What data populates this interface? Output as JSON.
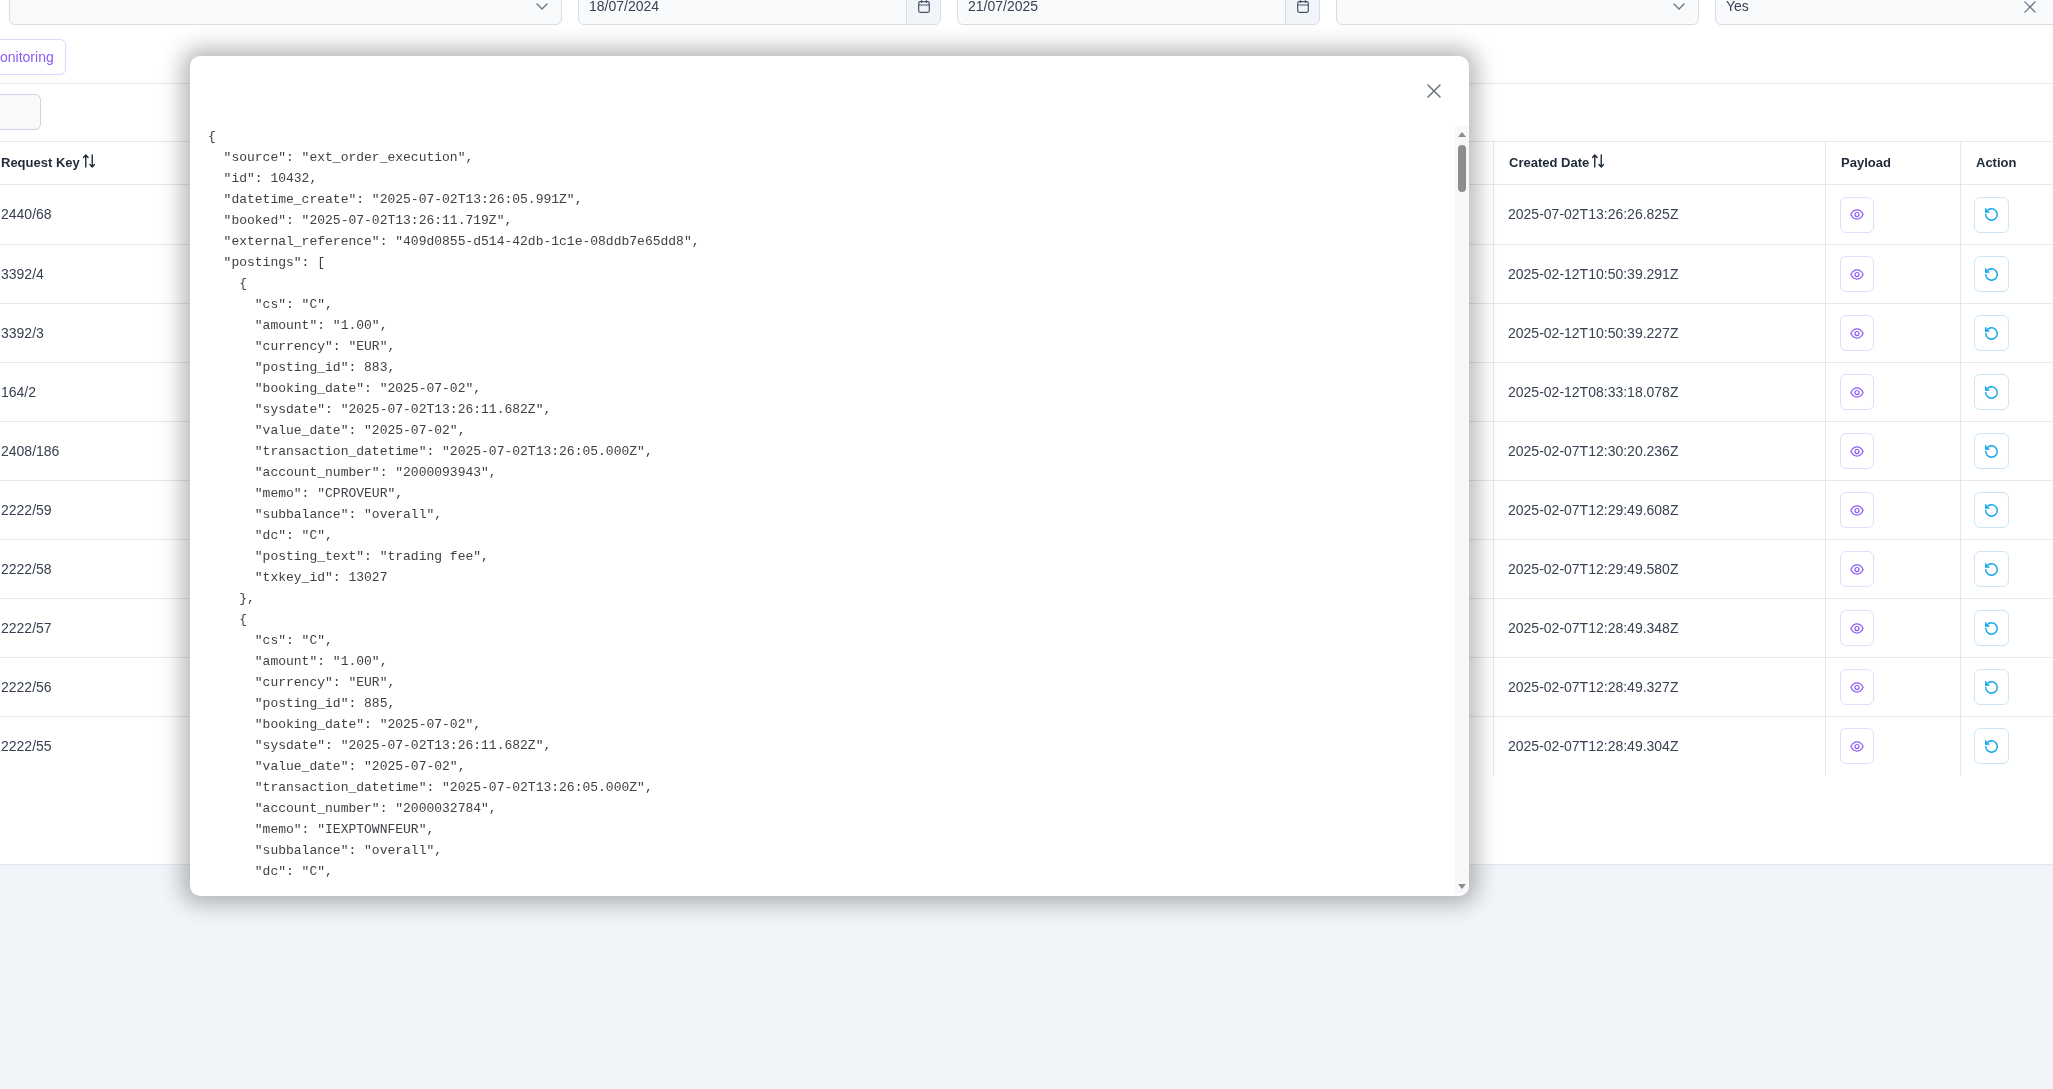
{
  "filters": [
    {
      "kind": "select"
    },
    {
      "kind": "date",
      "value": "18/07/2024"
    },
    {
      "kind": "date",
      "value": "21/07/2025"
    },
    {
      "kind": "select"
    },
    {
      "kind": "clearable",
      "value": "Yes"
    }
  ],
  "toolbar": {
    "button_label": "onitoring"
  },
  "table": {
    "columns": [
      {
        "label": "Request Key",
        "sortable": true,
        "kind": "text"
      },
      {
        "label": "Created Date",
        "sortable": true,
        "kind": "text"
      },
      {
        "label": "Payload",
        "sortable": false,
        "kind": "view"
      },
      {
        "label": "Action",
        "sortable": false,
        "kind": "retry"
      }
    ],
    "rows": [
      {
        "cells": [
          "2440/68",
          "2025-07-02T13:26:26.825Z"
        ]
      },
      {
        "cells": [
          "3392/4",
          "2025-02-12T10:50:39.291Z"
        ]
      },
      {
        "cells": [
          "3392/3",
          "2025-02-12T10:50:39.227Z"
        ]
      },
      {
        "cells": [
          "164/2",
          "2025-02-12T08:33:18.078Z"
        ]
      },
      {
        "cells": [
          "2408/186",
          "2025-02-07T12:30:20.236Z"
        ]
      },
      {
        "cells": [
          "2222/59",
          "2025-02-07T12:29:49.608Z"
        ]
      },
      {
        "cells": [
          "2222/58",
          "2025-02-07T12:29:49.580Z"
        ]
      },
      {
        "cells": [
          "2222/57",
          "2025-02-07T12:28:49.348Z"
        ]
      },
      {
        "cells": [
          "2222/56",
          "2025-02-07T12:28:49.327Z"
        ]
      },
      {
        "cells": [
          "2222/55",
          "2025-02-07T12:28:49.304Z"
        ]
      }
    ]
  },
  "payload_dialog": {
    "lines": [
      "{",
      "  \"source\": \"ext_order_execution\",",
      "  \"id\": 10432,",
      "  \"datetime_create\": \"2025-07-02T13:26:05.991Z\",",
      "  \"booked\": \"2025-07-02T13:26:11.719Z\",",
      "  \"external_reference\": \"409d0855-d514-42db-1c1e-08ddb7e65dd8\",",
      "  \"postings\": [",
      "    {",
      "      \"cs\": \"C\",",
      "      \"amount\": \"1.00\",",
      "      \"currency\": \"EUR\",",
      "      \"posting_id\": 883,",
      "      \"booking_date\": \"2025-07-02\",",
      "      \"sysdate\": \"2025-07-02T13:26:11.682Z\",",
      "      \"value_date\": \"2025-07-02\",",
      "      \"transaction_datetime\": \"2025-07-02T13:26:05.000Z\",",
      "      \"account_number\": \"2000093943\",",
      "      \"memo\": \"CPROVEUR\",",
      "      \"subbalance\": \"overall\",",
      "      \"dc\": \"C\",",
      "      \"posting_text\": \"trading fee\",",
      "      \"txkey_id\": 13027",
      "    },",
      "    {",
      "      \"cs\": \"C\",",
      "      \"amount\": \"1.00\",",
      "      \"currency\": \"EUR\",",
      "      \"posting_id\": 885,",
      "      \"booking_date\": \"2025-07-02\",",
      "      \"sysdate\": \"2025-07-02T13:26:11.682Z\",",
      "      \"value_date\": \"2025-07-02\",",
      "      \"transaction_datetime\": \"2025-07-02T13:26:05.000Z\",",
      "      \"account_number\": \"2000032784\",",
      "      \"memo\": \"IEXPTOWNFEUR\",",
      "      \"subbalance\": \"overall\",",
      "      \"dc\": \"C\","
    ]
  }
}
